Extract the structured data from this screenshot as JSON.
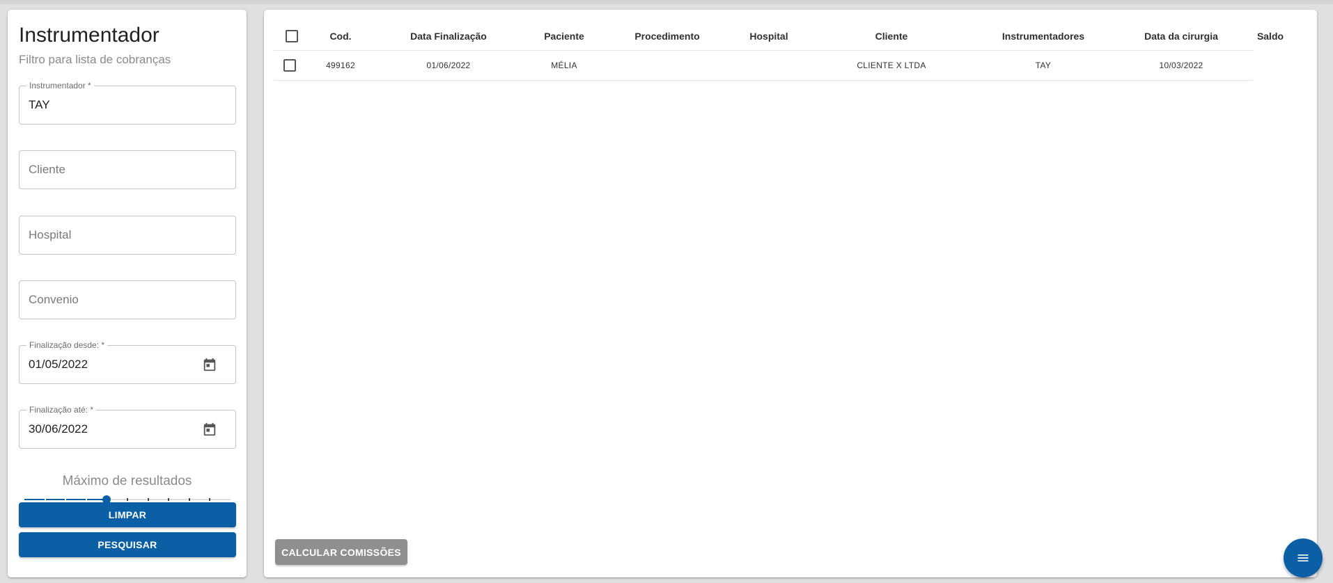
{
  "filter": {
    "title": "Instrumentador",
    "subtitle": "Filtro para lista de cobranças",
    "instrumentador": {
      "label": "Instrumentador *",
      "value": "TAY"
    },
    "cliente": {
      "placeholder": "Cliente"
    },
    "hospital": {
      "placeholder": "Hospital"
    },
    "convenio": {
      "placeholder": "Convenio"
    },
    "finalizacao_desde": {
      "label": "Finalização desde: *",
      "value": "01/05/2022"
    },
    "finalizacao_ate": {
      "label": "Finalização até: *",
      "value": "30/06/2022"
    },
    "max_results": {
      "label": "Máximo de resultados",
      "steps": 10,
      "selected_step": 4
    },
    "clear_label": "LIMPAR",
    "search_label": "PESQUISAR"
  },
  "table": {
    "columns": [
      "Cod.",
      "Data Finalização",
      "Paciente",
      "Procedimento",
      "Hospital",
      "Cliente",
      "Instrumentadores",
      "Data da cirurgia",
      "Saldo"
    ],
    "rows": [
      {
        "cod": "499162",
        "data_finalizacao": "01/06/2022",
        "paciente": "MÉLIA",
        "procedimento": "",
        "hospital": "",
        "cliente": "CLIENTE X LTDA",
        "instrumentadores": "TAY",
        "data_cirurgia": "10/03/2022",
        "saldo": ""
      }
    ]
  },
  "actions": {
    "calc_label": "CALCULAR COMISSÕES"
  },
  "icons": {
    "date": "calendar-icon",
    "fab": "menu-icon"
  },
  "colors": {
    "primary": "#0b5fa5",
    "disabled": "#8f8f8f"
  }
}
